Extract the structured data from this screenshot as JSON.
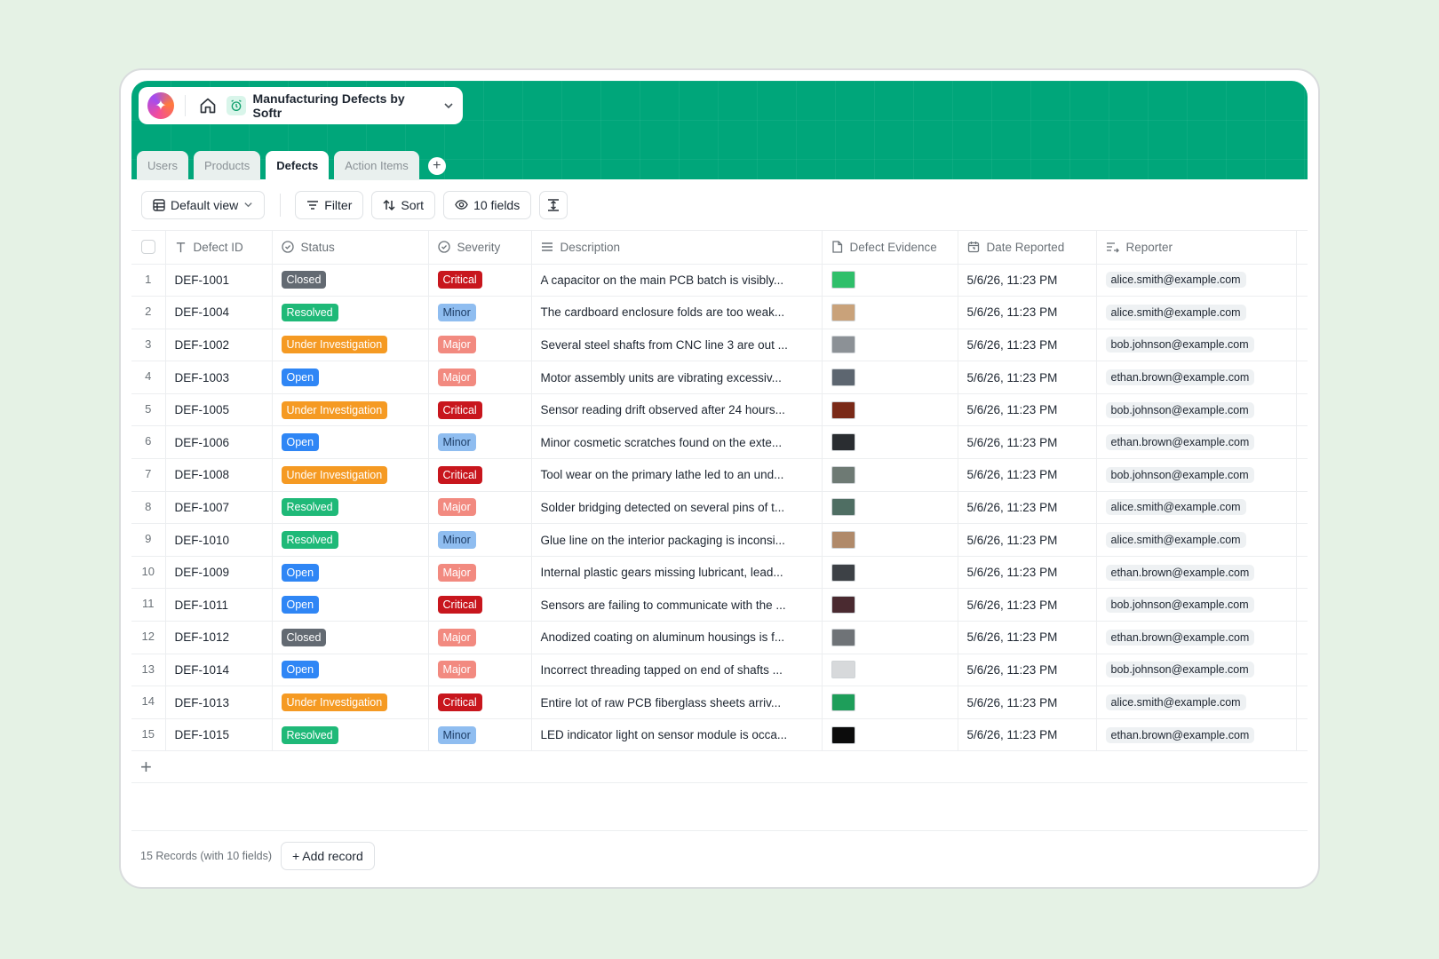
{
  "app": {
    "title": "Manufacturing Defects by Softr"
  },
  "tabs": [
    {
      "label": "Users"
    },
    {
      "label": "Products"
    },
    {
      "label": "Defects"
    },
    {
      "label": "Action Items"
    }
  ],
  "toolbar": {
    "view_label": "Default view",
    "filter_label": "Filter",
    "sort_label": "Sort",
    "fields_label": "10 fields"
  },
  "columns": [
    {
      "label": "Defect ID",
      "icon": "text-icon"
    },
    {
      "label": "Status",
      "icon": "status-icon"
    },
    {
      "label": "Severity",
      "icon": "status-icon"
    },
    {
      "label": "Description",
      "icon": "lines-icon"
    },
    {
      "label": "Defect Evidence",
      "icon": "file-icon"
    },
    {
      "label": "Date Reported",
      "icon": "calendar-icon"
    },
    {
      "label": "Reporter",
      "icon": "user-link-icon"
    }
  ],
  "status_colors": {
    "Closed": "#636a72",
    "Resolved": "#1fb978",
    "Under Investigation": "#f59a23",
    "Open": "#2f86f5"
  },
  "severity_colors": {
    "Critical": "#c8161d",
    "Minor": "#8fbdf0",
    "Major": "#f28a80"
  },
  "rows": [
    {
      "num": "1",
      "id": "DEF-1001",
      "status": "Closed",
      "severity": "Critical",
      "description": "A capacitor on the main PCB batch is visibly...",
      "evidence_color": "#2fbf6a",
      "date": "5/6/26, 11:23 PM",
      "reporter": "alice.smith@example.com"
    },
    {
      "num": "2",
      "id": "DEF-1004",
      "status": "Resolved",
      "severity": "Minor",
      "description": "The cardboard enclosure folds are too weak...",
      "evidence_color": "#c9a27a",
      "date": "5/6/26, 11:23 PM",
      "reporter": "alice.smith@example.com"
    },
    {
      "num": "3",
      "id": "DEF-1002",
      "status": "Under Investigation",
      "severity": "Major",
      "description": "Several steel shafts from CNC line 3 are out ...",
      "evidence_color": "#8c9196",
      "date": "5/6/26, 11:23 PM",
      "reporter": "bob.johnson@example.com"
    },
    {
      "num": "4",
      "id": "DEF-1003",
      "status": "Open",
      "severity": "Major",
      "description": "Motor assembly units are vibrating excessiv...",
      "evidence_color": "#5d6670",
      "date": "5/6/26, 11:23 PM",
      "reporter": "ethan.brown@example.com"
    },
    {
      "num": "5",
      "id": "DEF-1005",
      "status": "Under Investigation",
      "severity": "Critical",
      "description": "Sensor reading drift observed after 24 hours...",
      "evidence_color": "#7a2a18",
      "date": "5/6/26, 11:23 PM",
      "reporter": "bob.johnson@example.com"
    },
    {
      "num": "6",
      "id": "DEF-1006",
      "status": "Open",
      "severity": "Minor",
      "description": "Minor cosmetic scratches found on the exte...",
      "evidence_color": "#2a2d31",
      "date": "5/6/26, 11:23 PM",
      "reporter": "ethan.brown@example.com"
    },
    {
      "num": "7",
      "id": "DEF-1008",
      "status": "Under Investigation",
      "severity": "Critical",
      "description": "Tool wear on the primary lathe led to an und...",
      "evidence_color": "#6e7a74",
      "date": "5/6/26, 11:23 PM",
      "reporter": "bob.johnson@example.com"
    },
    {
      "num": "8",
      "id": "DEF-1007",
      "status": "Resolved",
      "severity": "Major",
      "description": "Solder bridging detected on several pins of t...",
      "evidence_color": "#4f6e63",
      "date": "5/6/26, 11:23 PM",
      "reporter": "alice.smith@example.com"
    },
    {
      "num": "9",
      "id": "DEF-1010",
      "status": "Resolved",
      "severity": "Minor",
      "description": "Glue line on the interior packaging is inconsi...",
      "evidence_color": "#b08a6a",
      "date": "5/6/26, 11:23 PM",
      "reporter": "alice.smith@example.com"
    },
    {
      "num": "10",
      "id": "DEF-1009",
      "status": "Open",
      "severity": "Major",
      "description": "Internal plastic gears missing lubricant, lead...",
      "evidence_color": "#3d4146",
      "date": "5/6/26, 11:23 PM",
      "reporter": "ethan.brown@example.com"
    },
    {
      "num": "11",
      "id": "DEF-1011",
      "status": "Open",
      "severity": "Critical",
      "description": "Sensors are failing to communicate with the ...",
      "evidence_color": "#4a2a30",
      "date": "5/6/26, 11:23 PM",
      "reporter": "bob.johnson@example.com"
    },
    {
      "num": "12",
      "id": "DEF-1012",
      "status": "Closed",
      "severity": "Major",
      "description": "Anodized coating on aluminum housings is f...",
      "evidence_color": "#6f7377",
      "date": "5/6/26, 11:23 PM",
      "reporter": "ethan.brown@example.com"
    },
    {
      "num": "13",
      "id": "DEF-1014",
      "status": "Open",
      "severity": "Major",
      "description": "Incorrect threading tapped on end of shafts ...",
      "evidence_color": "#d7d9db",
      "date": "5/6/26, 11:23 PM",
      "reporter": "bob.johnson@example.com"
    },
    {
      "num": "14",
      "id": "DEF-1013",
      "status": "Under Investigation",
      "severity": "Critical",
      "description": "Entire lot of raw PCB fiberglass sheets arriv...",
      "evidence_color": "#1e9e5a",
      "date": "5/6/26, 11:23 PM",
      "reporter": "alice.smith@example.com"
    },
    {
      "num": "15",
      "id": "DEF-1015",
      "status": "Resolved",
      "severity": "Minor",
      "description": "LED indicator light on sensor module is occa...",
      "evidence_color": "#0c0c0c",
      "date": "5/6/26, 11:23 PM",
      "reporter": "ethan.brown@example.com"
    }
  ],
  "footer": {
    "records_text": "15 Records (with 10 fields)",
    "add_record_label": "+ Add record"
  }
}
